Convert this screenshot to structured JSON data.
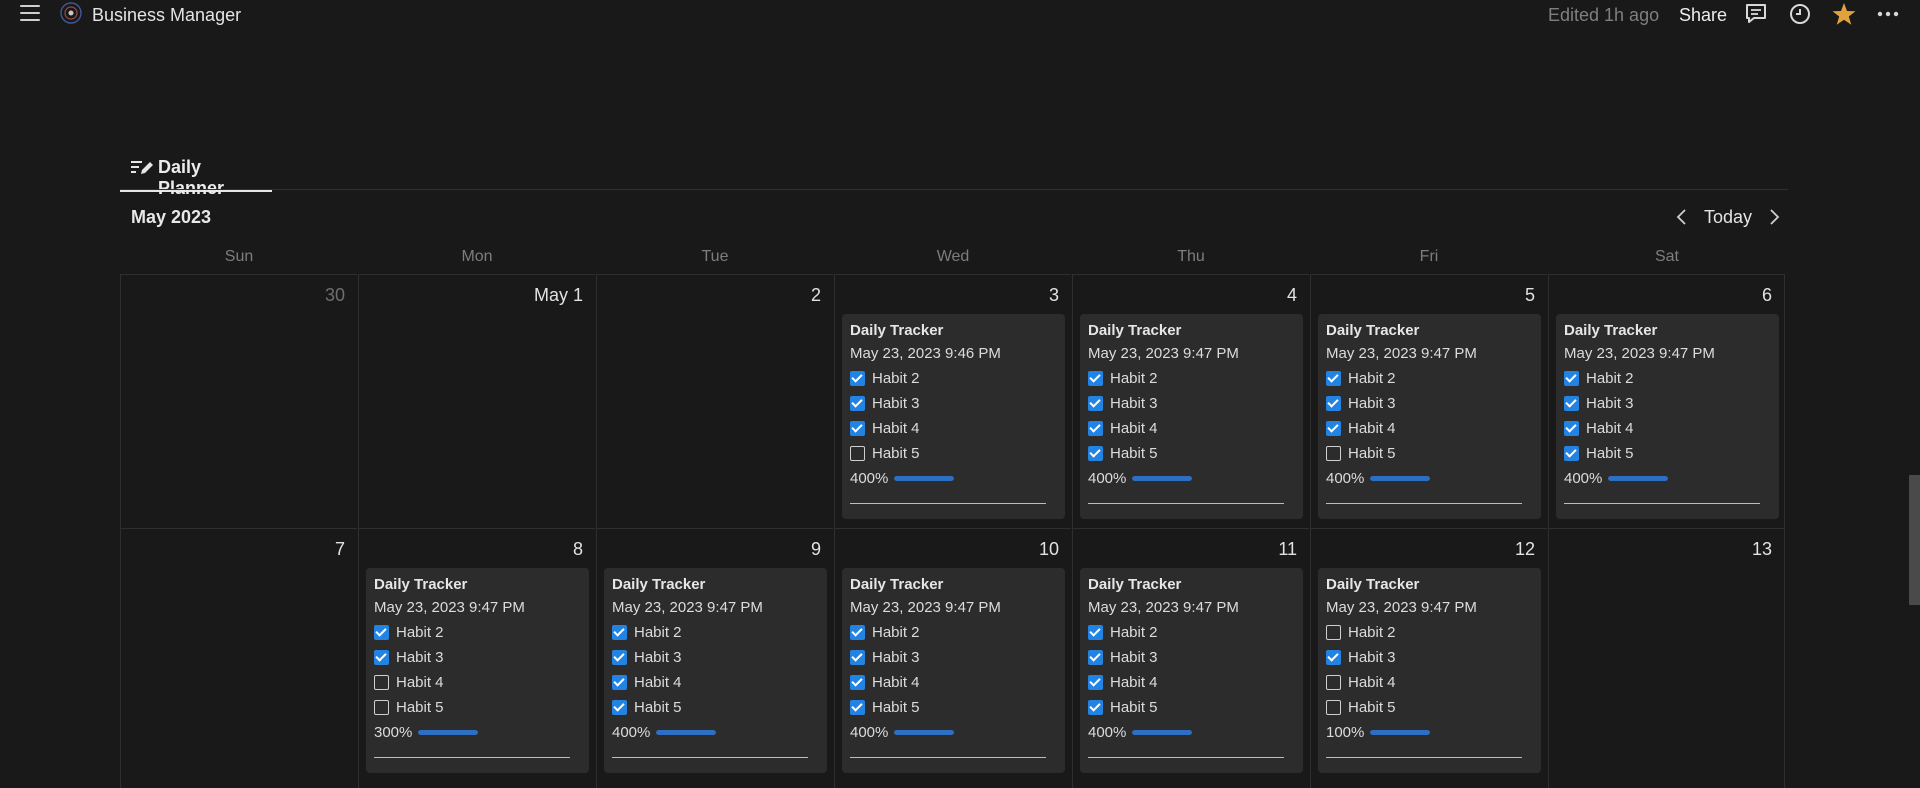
{
  "topbar": {
    "title": "Business Manager",
    "edited": "Edited 1h ago",
    "share": "Share",
    "icons": [
      "menu-icon",
      "comments-icon",
      "clock-icon",
      "star-icon",
      "more-icon"
    ]
  },
  "view": {
    "tab_label": "Daily Planner"
  },
  "calendar": {
    "month": "May 2023",
    "today_label": "Today",
    "weekdays": [
      "Sun",
      "Mon",
      "Tue",
      "Wed",
      "Thu",
      "Fri",
      "Sat"
    ],
    "weeks": [
      [
        {
          "day": "30",
          "muted": true
        },
        {
          "day": "May 1"
        },
        {
          "day": "2"
        },
        {
          "day": "3",
          "card": {
            "title": "Daily Tracker",
            "timestamp": "May 23, 2023 9:46 PM",
            "habits": [
              {
                "label": "Habit 2",
                "checked": true
              },
              {
                "label": "Habit 3",
                "checked": true
              },
              {
                "label": "Habit 4",
                "checked": true
              },
              {
                "label": "Habit 5",
                "checked": false
              }
            ],
            "progress": "400%"
          }
        },
        {
          "day": "4",
          "card": {
            "title": "Daily Tracker",
            "timestamp": "May 23, 2023 9:47 PM",
            "habits": [
              {
                "label": "Habit 2",
                "checked": true
              },
              {
                "label": "Habit 3",
                "checked": true
              },
              {
                "label": "Habit 4",
                "checked": true
              },
              {
                "label": "Habit 5",
                "checked": true
              }
            ],
            "progress": "400%"
          }
        },
        {
          "day": "5",
          "card": {
            "title": "Daily Tracker",
            "timestamp": "May 23, 2023 9:47 PM",
            "habits": [
              {
                "label": "Habit 2",
                "checked": true
              },
              {
                "label": "Habit 3",
                "checked": true
              },
              {
                "label": "Habit 4",
                "checked": true
              },
              {
                "label": "Habit 5",
                "checked": false
              }
            ],
            "progress": "400%"
          }
        },
        {
          "day": "6",
          "card": {
            "title": "Daily Tracker",
            "timestamp": "May 23, 2023 9:47 PM",
            "habits": [
              {
                "label": "Habit 2",
                "checked": true
              },
              {
                "label": "Habit 3",
                "checked": true
              },
              {
                "label": "Habit 4",
                "checked": true
              },
              {
                "label": "Habit 5",
                "checked": true
              }
            ],
            "progress": "400%"
          }
        }
      ],
      [
        {
          "day": "7"
        },
        {
          "day": "8",
          "card": {
            "title": "Daily Tracker",
            "timestamp": "May 23, 2023 9:47 PM",
            "habits": [
              {
                "label": "Habit 2",
                "checked": true
              },
              {
                "label": "Habit 3",
                "checked": true
              },
              {
                "label": "Habit 4",
                "checked": false
              },
              {
                "label": "Habit 5",
                "checked": false
              }
            ],
            "progress": "300%"
          }
        },
        {
          "day": "9",
          "card": {
            "title": "Daily Tracker",
            "timestamp": "May 23, 2023 9:47 PM",
            "habits": [
              {
                "label": "Habit 2",
                "checked": true
              },
              {
                "label": "Habit 3",
                "checked": true
              },
              {
                "label": "Habit 4",
                "checked": true
              },
              {
                "label": "Habit 5",
                "checked": true
              }
            ],
            "progress": "400%"
          }
        },
        {
          "day": "10",
          "card": {
            "title": "Daily Tracker",
            "timestamp": "May 23, 2023 9:47 PM",
            "habits": [
              {
                "label": "Habit 2",
                "checked": true
              },
              {
                "label": "Habit 3",
                "checked": true
              },
              {
                "label": "Habit 4",
                "checked": true
              },
              {
                "label": "Habit 5",
                "checked": true
              }
            ],
            "progress": "400%"
          }
        },
        {
          "day": "11",
          "card": {
            "title": "Daily Tracker",
            "timestamp": "May 23, 2023 9:47 PM",
            "habits": [
              {
                "label": "Habit 2",
                "checked": true
              },
              {
                "label": "Habit 3",
                "checked": true
              },
              {
                "label": "Habit 4",
                "checked": true
              },
              {
                "label": "Habit 5",
                "checked": true
              }
            ],
            "progress": "400%"
          }
        },
        {
          "day": "12",
          "card": {
            "title": "Daily Tracker",
            "timestamp": "May 23, 2023 9:47 PM",
            "habits": [
              {
                "label": "Habit 2",
                "checked": false
              },
              {
                "label": "Habit 3",
                "checked": true
              },
              {
                "label": "Habit 4",
                "checked": false
              },
              {
                "label": "Habit 5",
                "checked": false
              }
            ],
            "progress": "100%"
          }
        },
        {
          "day": "13"
        }
      ]
    ]
  },
  "colors": {
    "background": "#191919",
    "card": "#2c2c2c",
    "checkbox": "#2383e2",
    "progress": "#2e6fc4",
    "star": "#e2a23b"
  }
}
